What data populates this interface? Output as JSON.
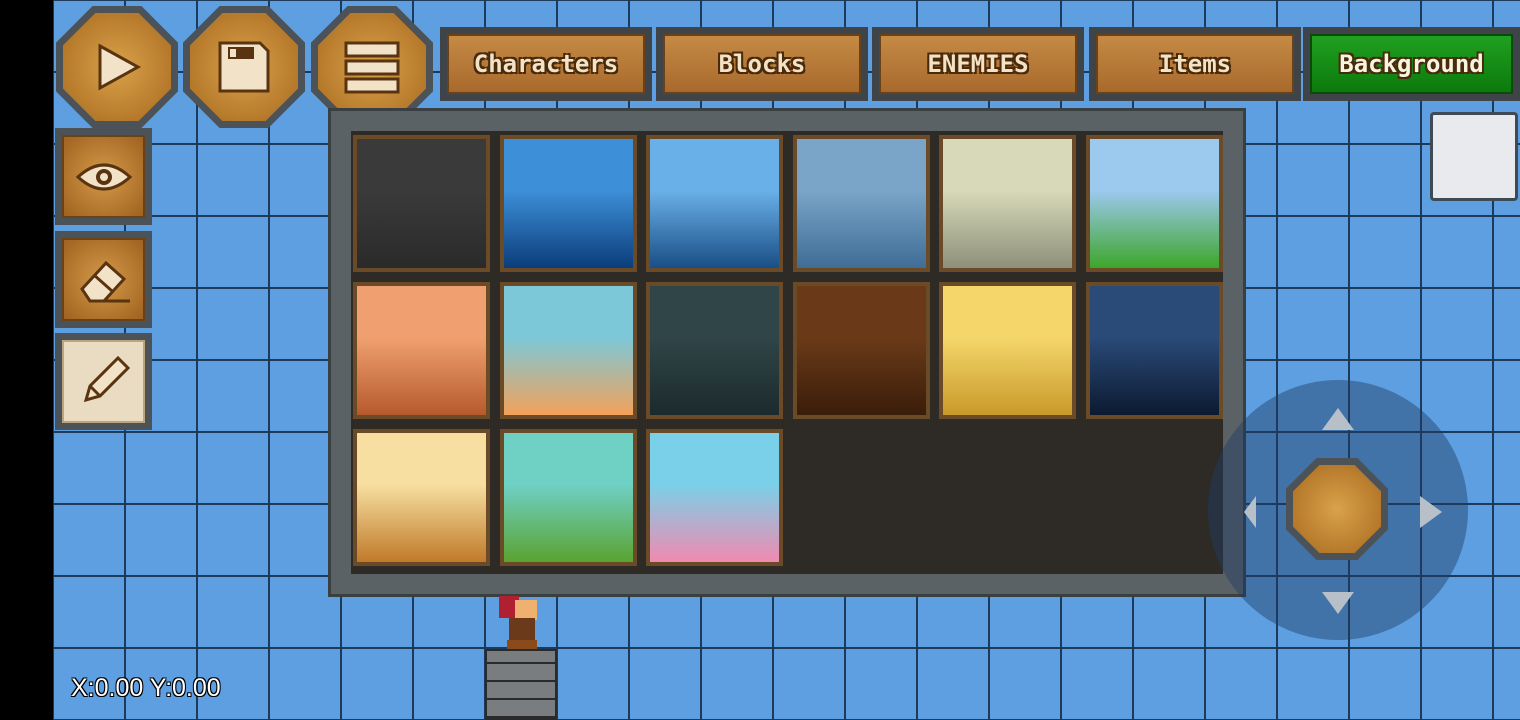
{
  "toolbar": {
    "play": "play-icon",
    "save": "save-icon",
    "menu": "menu-icon"
  },
  "tabs": [
    {
      "label": "Characters",
      "active": false
    },
    {
      "label": "Blocks",
      "active": false
    },
    {
      "label": "ENEMIES",
      "active": false
    },
    {
      "label": "Items",
      "active": false
    },
    {
      "label": "Background",
      "active": true
    }
  ],
  "tools": [
    {
      "name": "eye-icon"
    },
    {
      "name": "eraser-icon"
    },
    {
      "name": "pencil-icon",
      "selected": true
    }
  ],
  "backgrounds": [
    {
      "name": "stone-wall",
      "colors": [
        "#3a3a3a",
        "#2a2a2a"
      ]
    },
    {
      "name": "ice-sea",
      "colors": [
        "#3d8fd8",
        "#0b3d7a"
      ]
    },
    {
      "name": "iceberg",
      "colors": [
        "#6ab0e8",
        "#1a4e86"
      ]
    },
    {
      "name": "blue-forest",
      "colors": [
        "#7aa4c8",
        "#3f6d96"
      ]
    },
    {
      "name": "dead-trees",
      "colors": [
        "#d7d9b8",
        "#8e907a"
      ]
    },
    {
      "name": "green-meadow",
      "colors": [
        "#9cc9ee",
        "#3da62a"
      ]
    },
    {
      "name": "desert-canyon",
      "colors": [
        "#f0a070",
        "#b65a2c"
      ]
    },
    {
      "name": "mountain-lake",
      "colors": [
        "#7cc8d8",
        "#f3a25a"
      ]
    },
    {
      "name": "night-moon-forest",
      "colors": [
        "#2f4548",
        "#1c2a2c"
      ]
    },
    {
      "name": "brown-moon-forest",
      "colors": [
        "#6a3a18",
        "#3a1d0a"
      ]
    },
    {
      "name": "sun-desert",
      "colors": [
        "#f5d66a",
        "#c89a2a"
      ]
    },
    {
      "name": "blue-cave",
      "colors": [
        "#2a4a78",
        "#0c1a30"
      ]
    },
    {
      "name": "sunset-mesa",
      "colors": [
        "#f6dfa0",
        "#c07a2a"
      ]
    },
    {
      "name": "green-hills",
      "colors": [
        "#6fd0c4",
        "#5aa330"
      ]
    },
    {
      "name": "candy-land",
      "colors": [
        "#7ad0e8",
        "#f08ab0"
      ]
    }
  ],
  "joystick": {
    "up": "arrow-up-icon",
    "down": "arrow-down-icon",
    "left": "arrow-left-icon",
    "right": "arrow-right-icon"
  },
  "coords": "X:0.00 Y:0.00"
}
